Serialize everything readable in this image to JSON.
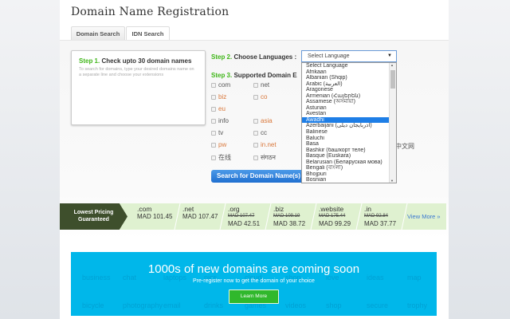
{
  "title": "Domain Name Registration",
  "tabs": [
    {
      "label": "Domain Search"
    },
    {
      "label": "IDN Search"
    }
  ],
  "step1": {
    "num": "Step 1.",
    "text": "Check upto 30 domain names",
    "hint": "To search for domains, type your desired domains name on a separate line and choose your extensions"
  },
  "step2": {
    "num": "Step 2.",
    "text": "Choose Languages :",
    "selected": "Select Language"
  },
  "step3": {
    "num": "Step 3.",
    "text": "Supported Domain E"
  },
  "extensions": [
    {
      "label": "com",
      "orange": false
    },
    {
      "label": "net",
      "orange": false
    },
    {
      "label": "biz",
      "orange": true
    },
    {
      "label": "co",
      "orange": true
    },
    {
      "label": "eu",
      "orange": true
    },
    {
      "label": "info",
      "orange": false
    },
    {
      "label": "asia",
      "orange": true
    },
    {
      "label": "tv",
      "orange": false
    },
    {
      "label": "cc",
      "orange": false
    },
    {
      "label": "pw",
      "orange": true
    },
    {
      "label": "in.net",
      "orange": true
    },
    {
      "label": "在线",
      "orange": false
    },
    {
      "label": "संगठन",
      "orange": false
    }
  ],
  "ext_partial": "中文网",
  "languages": [
    "Select Language",
    "Afrikaan",
    "Albanian (Shqip)",
    "Arabic (العربية)",
    "Aragonese",
    "Armenian (Հայերեն)",
    "Assamese (অসমীয়া)",
    "Asturian",
    "Avestan",
    "Awadhi",
    "Azerbaijani (آذربایجان دیلی)",
    "Balinese",
    "Baluchi",
    "Basa",
    "Bashkir (башҡорт теле)",
    "Basque (Euskara)",
    "Belarusian (Беларуская мова)",
    "Bengali (বাংলা)",
    "Bhojpuri",
    "Bosnian"
  ],
  "language_highlighted": "Awadhi",
  "search_button": "Search for Domain Name(s)",
  "pricing": {
    "tag": "Lowest Pricing Guaranteed",
    "view_more": "View More »",
    "items": [
      {
        "ext": ".com",
        "old": "",
        "price": "MAD 101.45"
      },
      {
        "ext": ".net",
        "old": "",
        "price": "MAD 107.47"
      },
      {
        "ext": ".org",
        "old": "MAD 107.47",
        "price": "MAD 42.51"
      },
      {
        "ext": ".biz",
        "old": "MAD 109.19",
        "price": "MAD 38.72"
      },
      {
        "ext": ".website",
        "old": "MAD 175.44",
        "price": "MAD 99.29"
      },
      {
        "ext": ".in",
        "old": "MAD 92.84",
        "price": "MAD 37.77"
      }
    ]
  },
  "banner": {
    "heading": "1000s of new domains are coming soon",
    "sub": "Pre-register now to get the domain of your choice",
    "button": "Learn More",
    "bg_words": [
      "business",
      "chat",
      "laptops",
      "pics",
      "cloud",
      "shop",
      "love",
      "ideas",
      "map",
      "bicycle",
      "photography",
      "email",
      "drinks",
      "games",
      "videos",
      "shop",
      "secure",
      "trophy"
    ]
  }
}
